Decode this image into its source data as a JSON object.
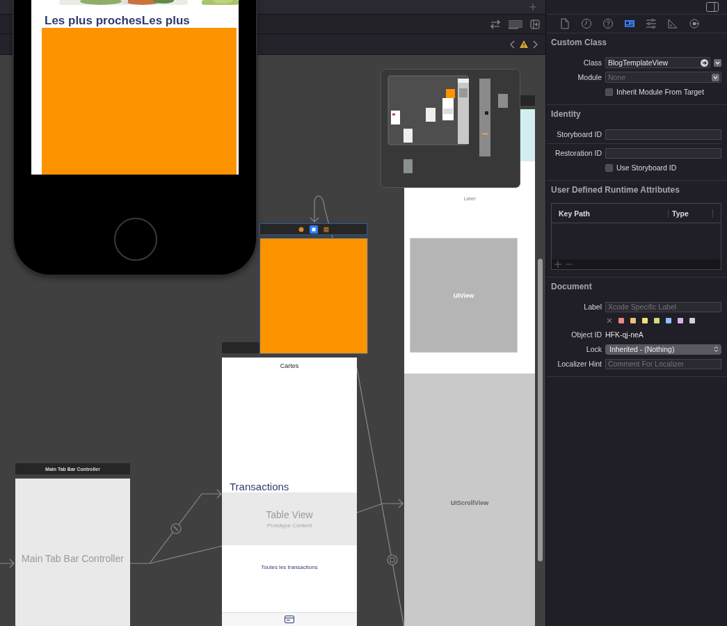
{
  "phone_preview": {
    "heading": "Les plus prochesLes plus"
  },
  "canvas": {
    "tab_bar_controller": {
      "title": "Main Tab Bar Controller",
      "label": "Main Tab Bar Controller"
    },
    "cartes_scene": {
      "title": "Cartes",
      "section_title": "Transactions",
      "table_view": {
        "title": "Table View",
        "subtitle": "Prototype Content"
      },
      "link": "Toutes les transactions"
    },
    "orange_scene": {
      "dock": [
        {
          "kind": "controller",
          "selected": false
        },
        {
          "kind": "view",
          "selected": true
        },
        {
          "kind": "exit",
          "selected": false
        }
      ]
    },
    "view_scene": {
      "label": "Label",
      "subview": "UIView",
      "scroll_view": "UIScrollView"
    }
  },
  "inspector": {
    "tabs": [
      {
        "kind": "file",
        "selected": false
      },
      {
        "kind": "history",
        "selected": false
      },
      {
        "kind": "help",
        "selected": false
      },
      {
        "kind": "identity",
        "selected": true
      },
      {
        "kind": "attributes",
        "selected": false
      },
      {
        "kind": "size",
        "selected": false
      },
      {
        "kind": "connections",
        "selected": false
      }
    ],
    "custom_class": {
      "title": "Custom Class",
      "class_label": "Class",
      "class_value": "BlogTemplateView",
      "module_label": "Module",
      "module_placeholder": "None",
      "inherit": {
        "label": "Inherit Module From Target",
        "checked": false
      }
    },
    "identity": {
      "title": "Identity",
      "storyboard_id_label": "Storyboard ID",
      "restoration_id_label": "Restoration ID",
      "use_storyboard_id": {
        "label": "Use Storyboard ID",
        "checked": false
      }
    },
    "runtime_attributes": {
      "title": "User Defined Runtime Attributes",
      "columns": [
        "Key Path",
        "Type"
      ]
    },
    "document": {
      "title": "Document",
      "label_label": "Label",
      "label_placeholder": "Xcode Specific Label",
      "color_tags": [
        {
          "color": "#e98a87"
        },
        {
          "color": "#f3bd78"
        },
        {
          "color": "#efe07a"
        },
        {
          "color": "#c8e07c"
        },
        {
          "color": "#8ec2f4"
        },
        {
          "color": "#d7b3e8"
        },
        {
          "color": "#d0d0d0"
        }
      ],
      "object_id_label": "Object ID",
      "object_id": "HFK-qj-neA",
      "lock_label": "Lock",
      "lock_value": "Inherited - (Nothing)",
      "localizer_hint_label": "Localizer Hint",
      "localizer_hint_placeholder": "Comment For Localizer"
    }
  }
}
